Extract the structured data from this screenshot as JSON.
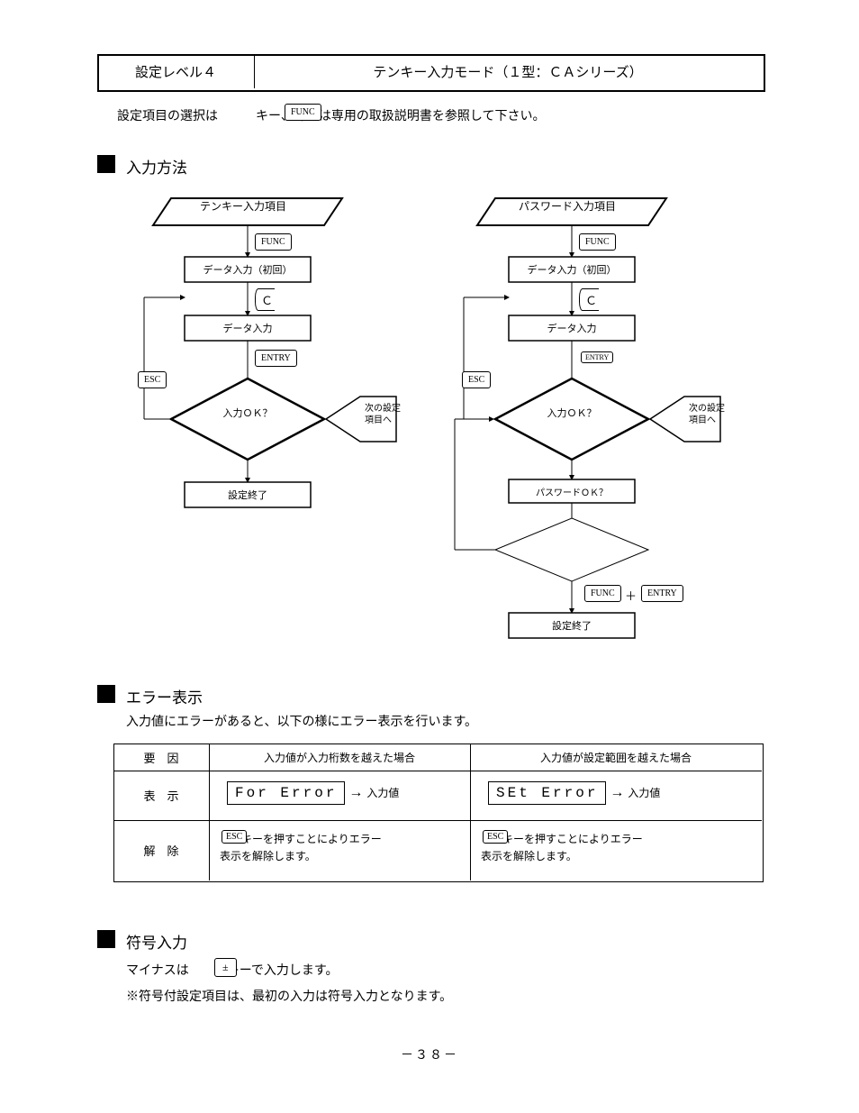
{
  "header": {
    "left": "設定レベル４",
    "right": "テンキー入力モード（１型：ＣＡシリーズ）"
  },
  "intro": "設定項目の選択は　　　キー、詳細は専用の取扱説明書を参照して下さい。",
  "introKey": "FUNC",
  "sec1": {
    "title": "入力方法",
    "left": {
      "start": "テンキー入力項目",
      "step1": "データ入力（初回）",
      "step2": "データ入力",
      "decision": "入力ＯＫ？",
      "keyEsc": "ESC",
      "keyFunc": "FUNC",
      "sideNote": "次の設定\n項目へ",
      "keyEntry": "ENTRY",
      "end": "設定終了",
      "keyC": "Ｃ"
    },
    "right": {
      "start": "パスワード入力項目",
      "step1": "データ入力（初回）",
      "step2": "データ入力",
      "decision": "入力ＯＫ？",
      "keyEsc": "ESC",
      "keyEntry": "ENTRY",
      "sideNote": "次の設定\n項目へ",
      "step3": "パスワードＯＫ？",
      "endKeys": {
        "a": "FUNC",
        "b": "ENTRY",
        "plus": "＋"
      },
      "end": "設定終了",
      "keyC": "Ｃ"
    }
  },
  "sec2": {
    "title": "エラー表示",
    "lead": "入力値にエラーがあると、以下の様にエラー表示を行います。",
    "table": {
      "h1": "要　因",
      "h2": "入力値が入力桁数を越えた場合",
      "h3": "入力値が設定範囲を越えた場合",
      "r1c1": "表　示",
      "r1c2a": "For  Error",
      "r1c2b": "入力値",
      "r1c3a": "SEt  Error",
      "r1c3b": "入力値",
      "r2c1": "解　除",
      "r2c2": "　　キーを押すことによりエラー\n表示を解除します。",
      "r2c3": "　　キーを押すことによりエラー\n表示を解除します。",
      "r2key": "ESC"
    }
  },
  "sec3": {
    "title": "符号入力",
    "body1": "マイナスは　　　キーで入力します。",
    "key": "±",
    "body2": "※符号付設定項目は、最初の入力は符号入力となります。"
  },
  "pageNum": "－３８－"
}
